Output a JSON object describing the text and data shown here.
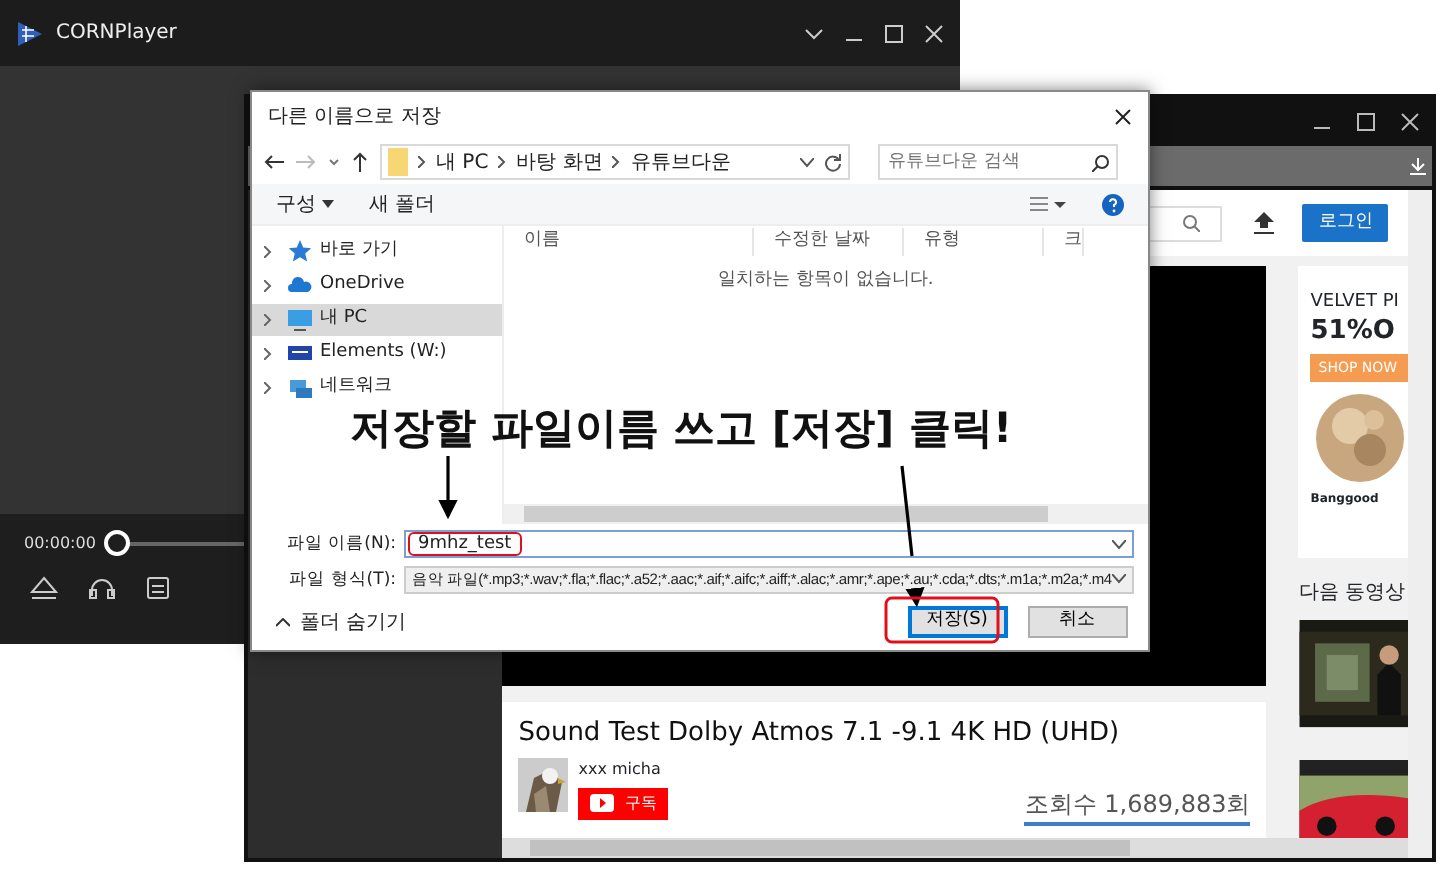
{
  "player": {
    "title": "CORNPlayer",
    "time": "00:00:00",
    "seek": {
      "level": 0
    }
  },
  "browser": {
    "login": "로그인",
    "ad": {
      "headline": "VELVET PI",
      "offer": "51%O",
      "button": "SHOP NOW",
      "brand": "Banggood"
    },
    "next_label": "다음 동영상",
    "video_title": "Sound Test Dolby Atmos 7.1 -9.1 4K HD (UHD)",
    "channel": "xxx micha",
    "subscribe": "구독",
    "views": "조회수 1,689,883회"
  },
  "dialog": {
    "title": "다른 이름으로 저장",
    "breadcrumb": [
      "내 PC",
      "바탕 화면",
      "유튜브다운"
    ],
    "search": {
      "placeholder": "유튜브다운 검색"
    },
    "toolbar": [
      "구성",
      "새 폴더"
    ],
    "nav": [
      {
        "label": "바로 가기",
        "kind": "star",
        "selected": false
      },
      {
        "label": "OneDrive",
        "kind": "cloud",
        "selected": false
      },
      {
        "label": "내 PC",
        "kind": "pc",
        "selected": true
      },
      {
        "label": "Elements (W:)",
        "kind": "drive",
        "selected": false
      },
      {
        "label": "네트워크",
        "kind": "network",
        "selected": false
      }
    ],
    "columns": [
      "이름",
      "수정한 날짜",
      "유형",
      "크"
    ],
    "empty_message": "일치하는 항목이 없습니다.",
    "filename_label": "파일 이름(N):",
    "filename": "9mhz_test",
    "filetype_label": "파일 형식(T):",
    "filetype": "음악 파일(*.mp3;*.wav;*.fla;*.flac;*.a52;*.aac;*.aif;*.aifc;*.aiff;*.alac;*.amr;*.ape;*.au;*.cda;*.dts;*.m1a;*.m2a;*.m4",
    "hide_folders": "폴더 숨기기",
    "buttons": [
      {
        "label": "저장(S)",
        "kind": "primary"
      },
      {
        "label": "취소",
        "kind": "cancel"
      }
    ]
  },
  "annotation": "저장할 파일이름 쓰고 [저장] 클릭!"
}
